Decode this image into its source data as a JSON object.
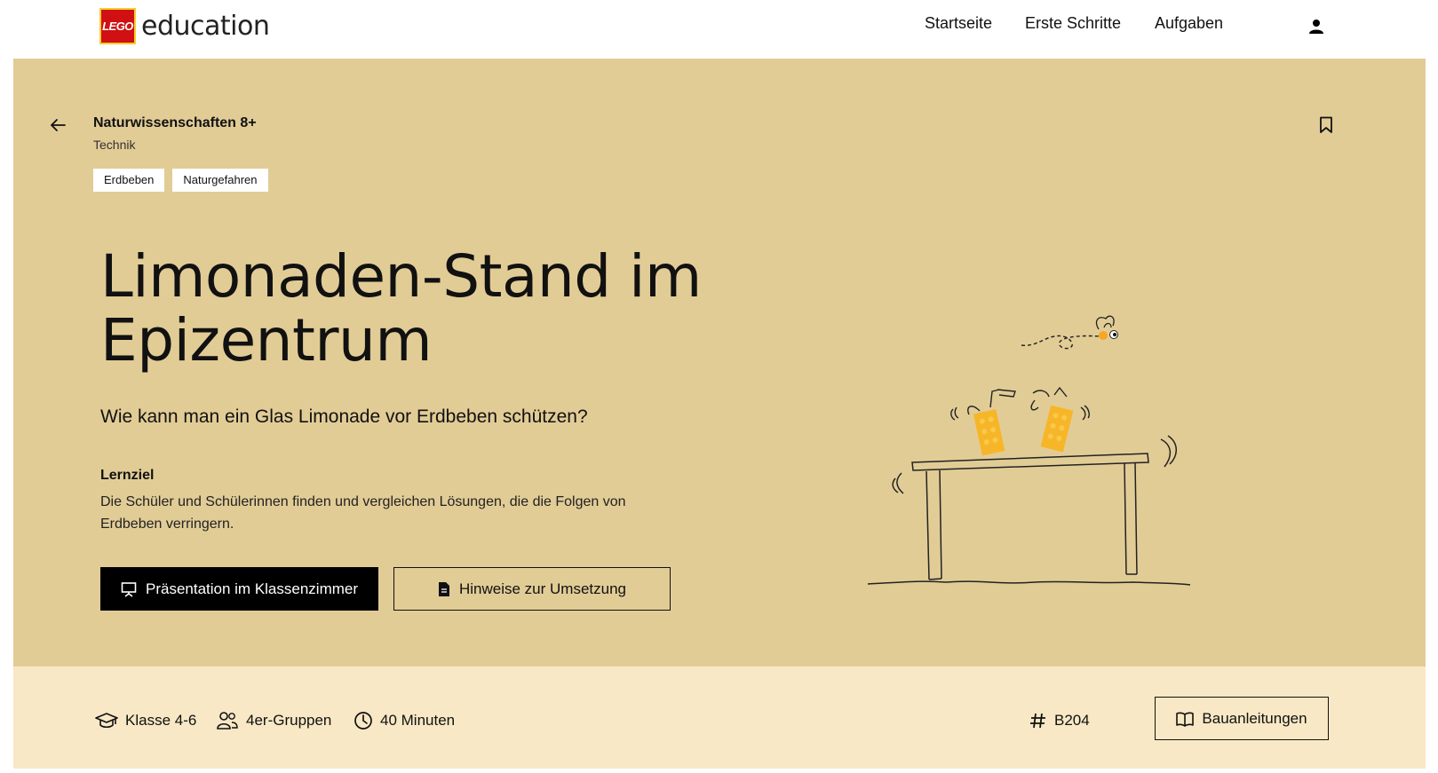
{
  "header": {
    "logo_lego": "LEGO",
    "logo_education": "education",
    "nav": [
      {
        "label": "Startseite"
      },
      {
        "label": "Erste Schritte"
      },
      {
        "label": "Aufgaben"
      }
    ],
    "icons": {
      "user": "user-icon"
    }
  },
  "hero": {
    "background_color": "#e2cc96",
    "breadcrumb": {
      "title": "Naturwissenschaften 8+",
      "subtitle": "Technik"
    },
    "tags": [
      "Erdbeben",
      "Naturgefahren"
    ],
    "title_line1": "Limonaden-Stand im",
    "title_line2": "Epizentrum",
    "question": "Wie kann man ein Glas Limonade vor Erdbeben schützen?",
    "goal_label": "Lernziel",
    "goal_text": "Die Schüler und Schülerinnen finden und vergleichen Lösungen, die die Folgen von Erdbeben verringern.",
    "buttons": {
      "presentation": "Präsentation im Klassenzimmer",
      "notes": "Hinweise zur Umsetzung"
    },
    "icons": {
      "back": "arrow-left-icon",
      "bookmark": "bookmark-icon",
      "presentation": "presentation-icon",
      "document": "document-icon"
    }
  },
  "info": {
    "background_color": "#f8e8c5",
    "grade": "Klasse 4-6",
    "groups": "4er-Gruppen",
    "duration": "40 Minuten",
    "code": "B204",
    "build_button": "Bauanleitungen",
    "icons": {
      "grade": "graduation-cap-icon",
      "groups": "group-icon",
      "duration": "clock-icon",
      "code": "hash-icon",
      "build": "book-icon"
    }
  }
}
